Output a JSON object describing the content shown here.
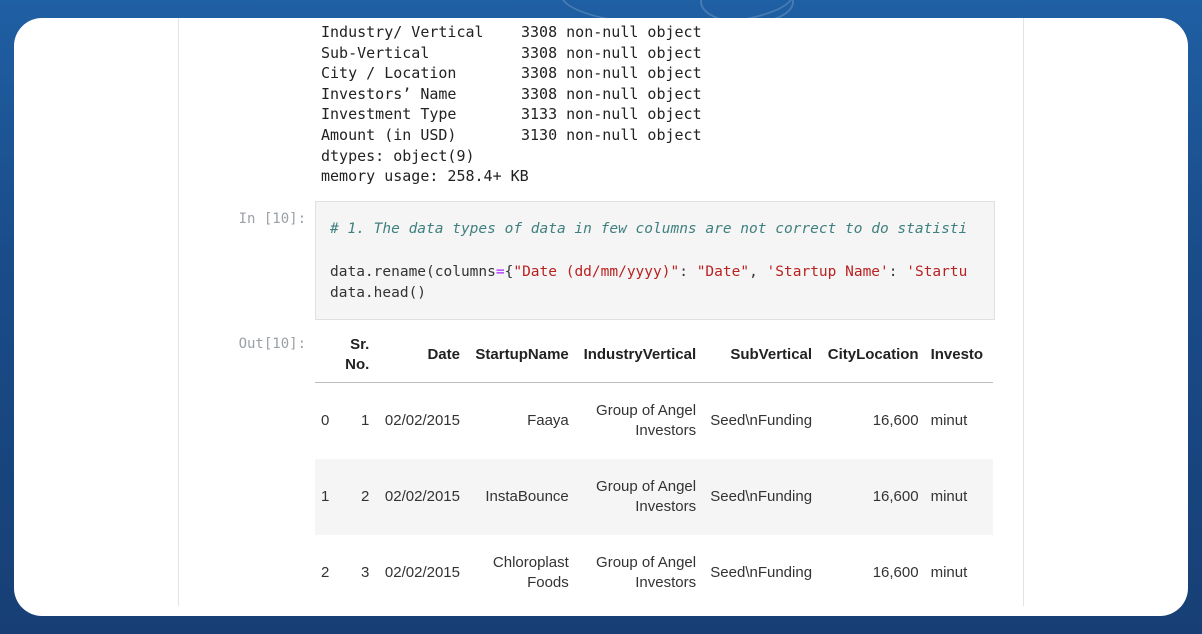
{
  "info_rows": [
    {
      "column": "Industry/ Vertical",
      "dtype": "3308 non-null object"
    },
    {
      "column": "Sub-Vertical",
      "dtype": "3308 non-null object"
    },
    {
      "column": "City / Location",
      "dtype": "3308 non-null object"
    },
    {
      "column": "Investors’ Name",
      "dtype": "3308 non-null object"
    },
    {
      "column": "Investment Type",
      "dtype": "3133 non-null object"
    },
    {
      "column": "Amount (in USD)",
      "dtype": "3130 non-null object"
    }
  ],
  "info_dtypes": "dtypes: object(9)",
  "info_memory": "memory usage: 258.4+ KB",
  "input_prompt": "In [10]:",
  "output_prompt": "Out[10]:",
  "code": {
    "comment": "# 1. The data types of data in few columns are not correct to do statisti",
    "line2_prefix": "data.rename(columns",
    "line2_eq": "=",
    "line2_brace": "{",
    "line2_str1": "\"Date (dd/mm/yyyy)\"",
    "line2_colon1": ": ",
    "line2_str2": "\"Date\"",
    "line2_comma": ", ",
    "line2_str3": "'Startup Name'",
    "line2_colon2": ": ",
    "line2_str4": "'Startu",
    "line3": "data.head()"
  },
  "table": {
    "headers": [
      "",
      "Sr. No.",
      "Date",
      "StartupName",
      "IndustryVertical",
      "SubVertical",
      "CityLocation",
      "Investo"
    ],
    "rows": [
      {
        "idx": "0",
        "sr": "1",
        "date": "02/02/2015",
        "name": "Faaya",
        "industry": "Group of Angel Investors",
        "sub": "Seed\\nFunding",
        "city": "16,600",
        "inv": "minut"
      },
      {
        "idx": "1",
        "sr": "2",
        "date": "02/02/2015",
        "name": "InstaBounce",
        "industry": "Group of Angel Investors",
        "sub": "Seed\\nFunding",
        "city": "16,600",
        "inv": "minut"
      },
      {
        "idx": "2",
        "sr": "3",
        "date": "02/02/2015",
        "name": "Chloroplast Foods",
        "industry": "Group of Angel Investors",
        "sub": "Seed\\nFunding",
        "city": "16,600",
        "inv": "minut"
      }
    ]
  },
  "colors": {
    "background": "#1c4a85",
    "card": "#ffffff",
    "code_bg": "#f5f5f5",
    "string": "#ba2121",
    "comment": "#408080"
  }
}
